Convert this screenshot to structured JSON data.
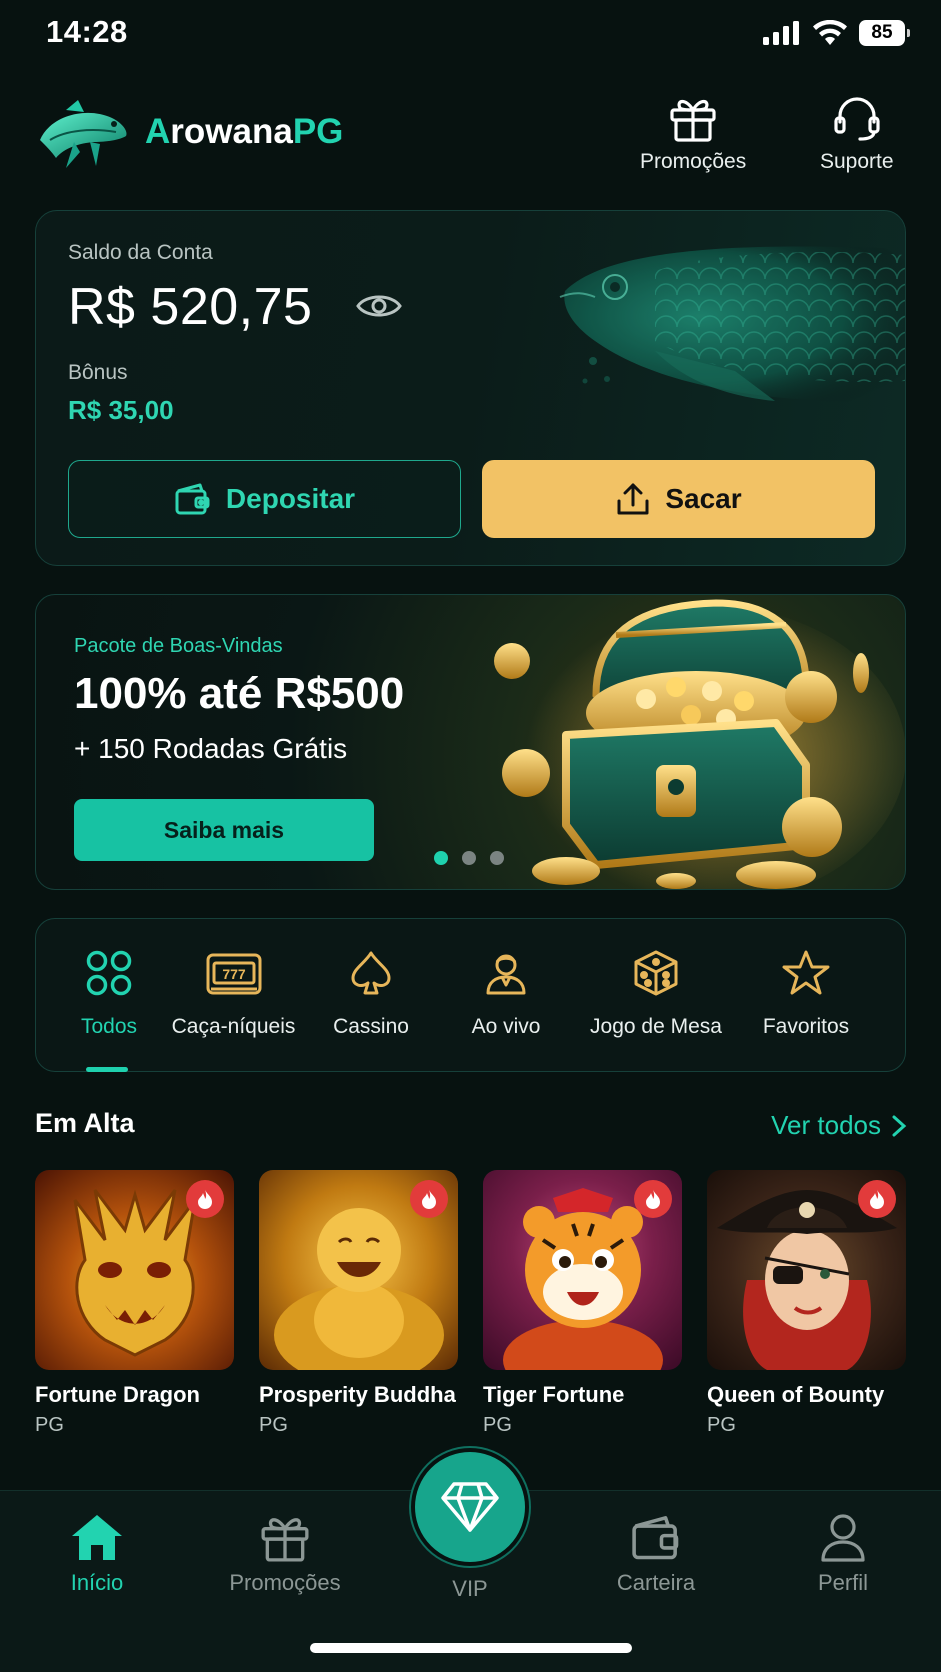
{
  "status": {
    "time": "14:28",
    "battery": "85"
  },
  "header": {
    "brand_first": "A",
    "brand_mid": "rowana",
    "brand_last": "PG",
    "promos_label": "Promoções",
    "support_label": "Suporte"
  },
  "balance": {
    "label": "Saldo da Conta",
    "value": "R$ 520,75",
    "bonus_label": "Bônus",
    "bonus_value": "R$ 35,00",
    "deposit_label": "Depositar",
    "withdraw_label": "Sacar"
  },
  "banner": {
    "subtitle": "Pacote de Boas-Vindas",
    "title": "100% até R$500",
    "line": "+ 150 Rodadas Grátis",
    "cta": "Saiba mais",
    "slides": 3,
    "active_slide": 1
  },
  "categories": [
    {
      "label": "Todos",
      "icon": "grid-icon",
      "active": true
    },
    {
      "label": "Caça-níqueis",
      "icon": "slot-machine-icon"
    },
    {
      "label": "Cassino",
      "icon": "spade-icon"
    },
    {
      "label": "Ao vivo",
      "icon": "dealer-icon"
    },
    {
      "label": "Jogo de Mesa",
      "icon": "dice-icon"
    },
    {
      "label": "Favoritos",
      "icon": "star-icon"
    }
  ],
  "trending": {
    "title": "Em Alta",
    "see_all": "Ver todos",
    "games": [
      {
        "name": "Fortune Dragon",
        "provider": "PG"
      },
      {
        "name": "Prosperity Buddha",
        "provider": "PG"
      },
      {
        "name": "Tiger Fortune",
        "provider": "PG"
      },
      {
        "name": "Queen of Bounty",
        "provider": "PG"
      }
    ]
  },
  "nav": {
    "home": "Início",
    "promos": "Promoções",
    "vip": "VIP",
    "wallet": "Carteira",
    "profile": "Perfil"
  },
  "colors": {
    "accent": "#22d3b0",
    "gold": "#f2c265",
    "background": "#071210",
    "hot_badge": "#e23b3b"
  }
}
